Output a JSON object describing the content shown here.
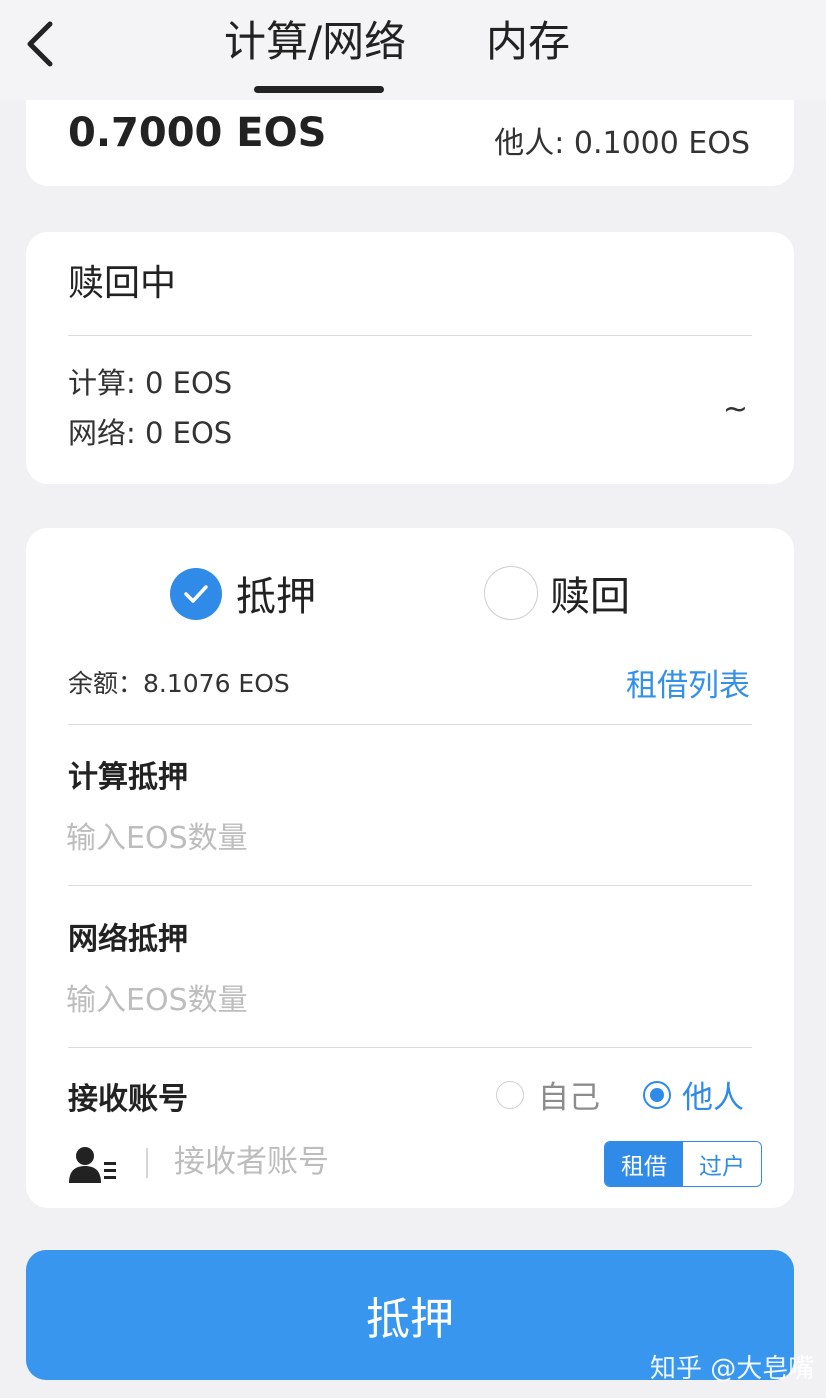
{
  "nav": {
    "tabs": [
      {
        "label": "计算/网络",
        "active": true
      },
      {
        "label": "内存",
        "active": false
      }
    ]
  },
  "staked": {
    "amount": "0.7000 EOS",
    "others": "他人: 0.1000 EOS"
  },
  "redeeming": {
    "title": "赎回中",
    "cpu": "计算: 0 EOS",
    "net": "网络: 0 EOS",
    "expand": "~"
  },
  "action": {
    "mode_stake": "抵押",
    "mode_redeem": "赎回",
    "selected_mode": "抵押",
    "balance": "余额：8.1076 EOS",
    "lease_list": "租借列表",
    "cpu_label": "计算抵押",
    "cpu_placeholder": "输入EOS数量",
    "net_label": "网络抵押",
    "net_placeholder": "输入EOS数量",
    "receiver_label": "接收账号",
    "receiver_self": "自己",
    "receiver_other": "他人",
    "receiver_selected": "他人",
    "receiver_placeholder": "接收者账号",
    "seg_lease": "租借",
    "seg_transfer": "过户",
    "seg_selected": "租借"
  },
  "submit_label": "抵押",
  "watermark": "知乎 @大皂嘴",
  "colors": {
    "accent": "#2f8ae8",
    "button": "#3896ef",
    "background": "#f1f1f3"
  }
}
